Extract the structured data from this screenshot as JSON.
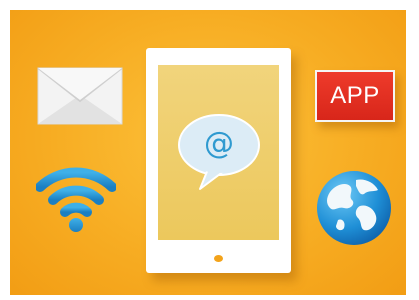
{
  "scene": {
    "background_color": "#f7ad23",
    "tablet_email_symbol": "@",
    "app_badge_label": "APP",
    "icons": [
      "envelope-icon",
      "wifi-icon",
      "globe-icon",
      "app-badge",
      "chat-bubble-icon"
    ],
    "colors": {
      "accent_blue": "#2f9ad0",
      "app_red": "#e0301f",
      "tablet_screen": "#eecb63"
    }
  }
}
